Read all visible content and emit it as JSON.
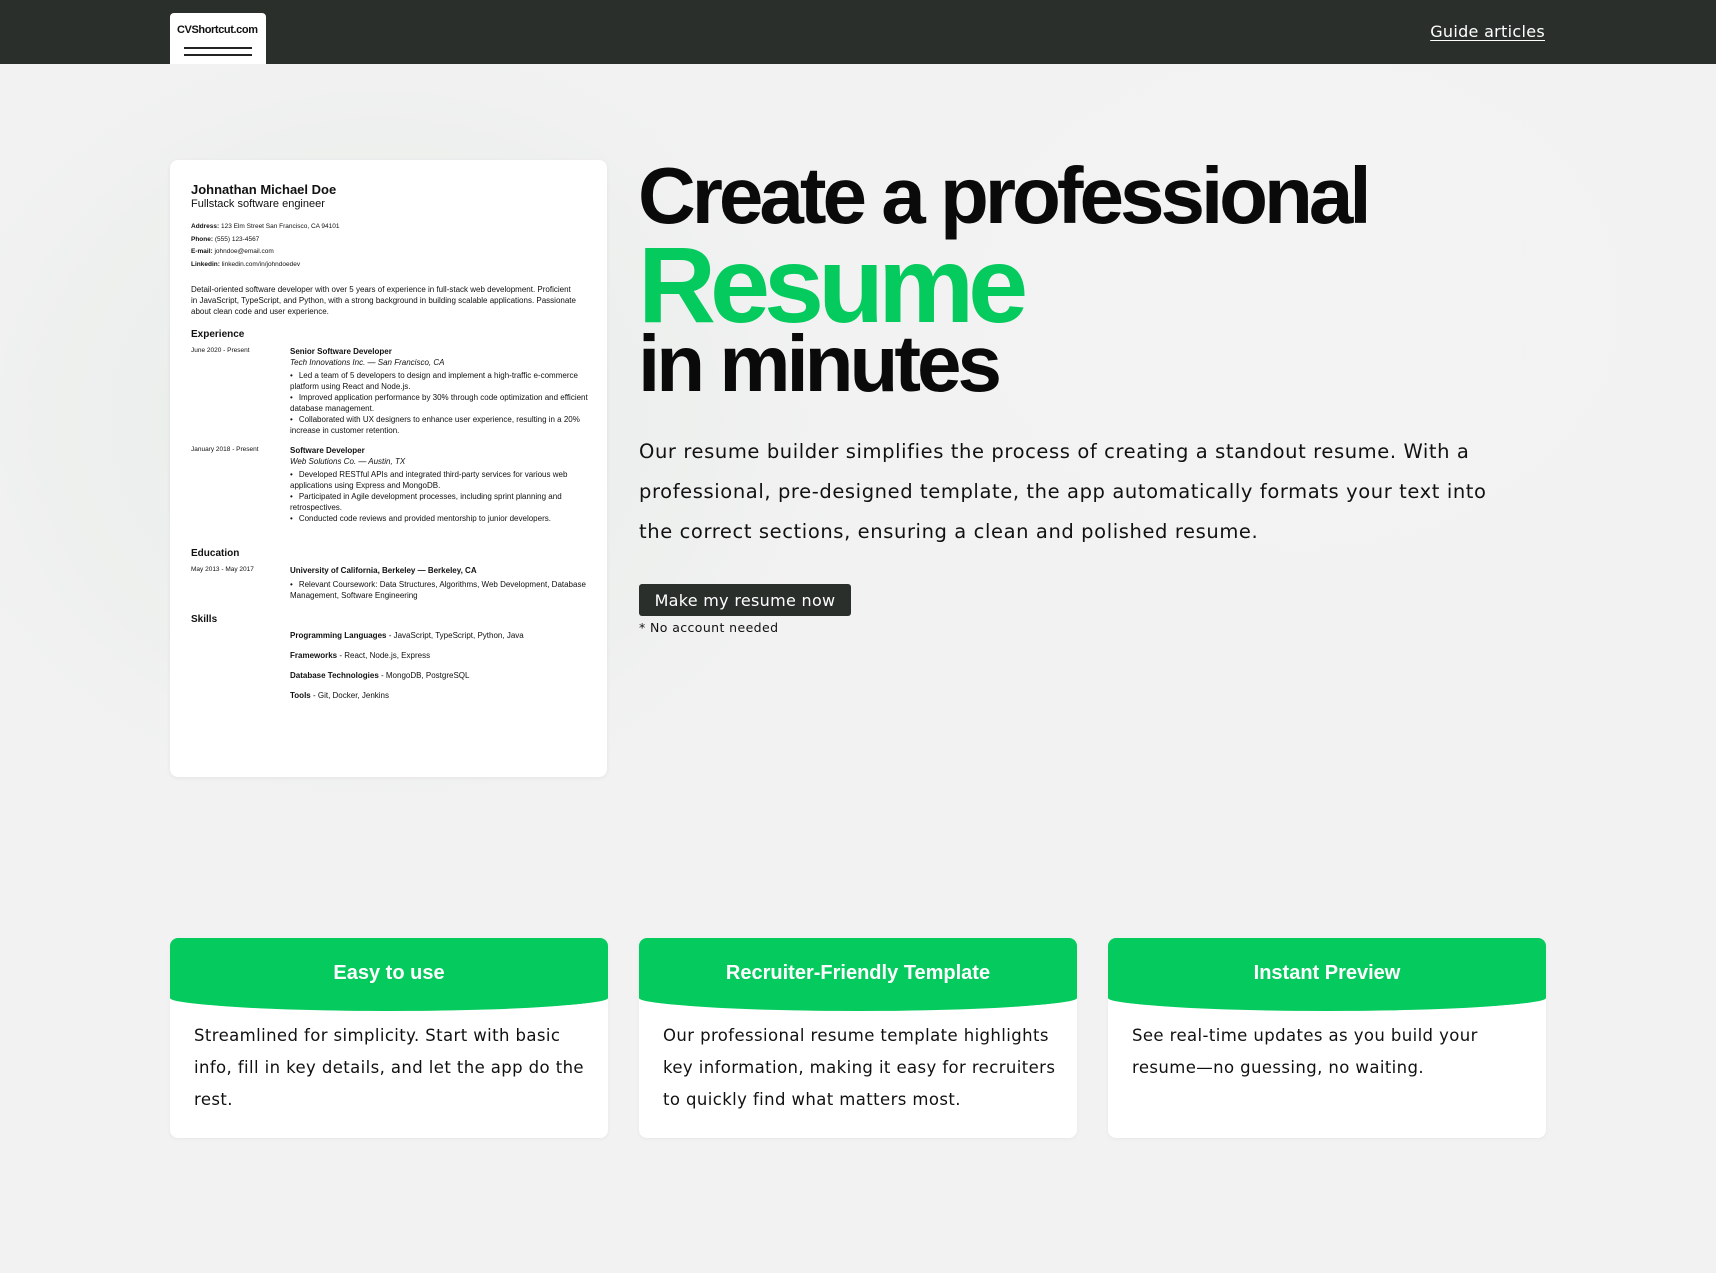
{
  "header": {
    "logo_text": "CVShortcut.com",
    "nav_link": "Guide articles"
  },
  "resume": {
    "name": "Johnathan Michael Doe",
    "title": "Fullstack software engineer",
    "contact": [
      {
        "label": "Address:",
        "value": "123 Elm Street San Francisco, CA 94101"
      },
      {
        "label": "Phone:",
        "value": "(555) 123-4567"
      },
      {
        "label": "E-mail:",
        "value": "johndoe@email.com"
      },
      {
        "label": "Linkedin:",
        "value": "linkedin.com/in/johndoedev"
      }
    ],
    "summary": "Detail-oriented software developer with over 5 years of experience in full-stack web development. Proficient in JavaScript, TypeScript, and Python, with a strong background in building scalable applications. Passionate about clean code and user experience.",
    "experience_heading": "Experience",
    "experience": [
      {
        "date": "June 2020 - Present",
        "role": "Senior Software Developer",
        "company": "Tech Innovations Inc. — San Francisco, CA",
        "bullets": [
          "Led a team of 5 developers to design and implement a high-traffic e-commerce platform using React and Node.js.",
          "Improved application performance by 30% through code optimization and efficient database management.",
          "Collaborated with UX designers to enhance user experience, resulting in a 20% increase in customer retention."
        ]
      },
      {
        "date": "January 2018 - Present",
        "role": "Software Developer",
        "company": "Web Solutions Co. — Austin, TX",
        "bullets": [
          "Developed RESTful APIs and integrated third-party services for various web applications using Express and MongoDB.",
          "Participated in Agile development processes, including sprint planning and retrospectives.",
          "Conducted code reviews and provided mentorship to junior developers."
        ]
      }
    ],
    "education_heading": "Education",
    "education": {
      "date": "May 2013 - May 2017",
      "school": "University of California, Berkeley — Berkeley, CA",
      "bullets": [
        "Relevant Coursework: Data Structures, Algorithms, Web Development, Database Management, Software Engineering"
      ]
    },
    "skills_heading": "Skills",
    "skills": [
      {
        "label": "Programming Languages",
        "value": " - JavaScript, TypeScript, Python, Java"
      },
      {
        "label": "Frameworks",
        "value": " - React, Node.js, Express"
      },
      {
        "label": "Database Technologies",
        "value": " - MongoDB, PostgreSQL"
      },
      {
        "label": "Tools",
        "value": " - Git, Docker, Jenkins"
      }
    ]
  },
  "hero": {
    "line1": "Create a professional",
    "line2": "Resume",
    "line3": "in minutes",
    "description": "Our resume builder simplifies the process of creating a standout resume. With a professional, pre-designed template, the app automatically formats your text into the correct sections, ensuring a clean and polished resume.",
    "cta_label": "Make my resume now",
    "cta_note": "* No account needed",
    "accent_color": "#05cb5e"
  },
  "features": [
    {
      "title": "Easy to use",
      "body": "Streamlined for simplicity. Start with basic info, fill in key details, and let the app do the rest."
    },
    {
      "title": "Recruiter-Friendly Template",
      "body": "Our professional resume template highlights key information, making it easy for recruiters to quickly find what matters most."
    },
    {
      "title": "Instant Preview",
      "body": "See real-time updates as you build your resume—no guessing, no waiting."
    }
  ]
}
